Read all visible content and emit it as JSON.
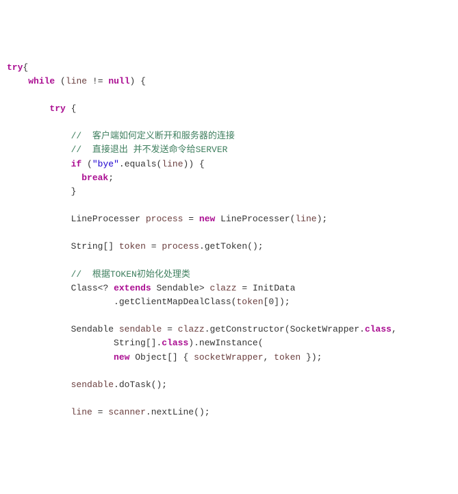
{
  "code": {
    "keywords": {
      "try": "try",
      "while": "while",
      "null": "null",
      "if": "if",
      "break": "break",
      "new": "new",
      "extends": "extends",
      "class": "class"
    },
    "identifiers": {
      "line": "line",
      "process": "process",
      "token": "token",
      "clazz": "clazz",
      "sendable": "sendable",
      "scanner": "scanner",
      "socketWrapper": "socketWrapper"
    },
    "types": {
      "LineProcesser": "LineProcesser",
      "String": "String",
      "Class": "Class",
      "Sendable": "Sendable",
      "InitData": "InitData",
      "SocketWrapper": "SocketWrapper",
      "Object": "Object"
    },
    "strings": {
      "bye": "\"bye\""
    },
    "comments": {
      "c1": "//  客户端如何定义断开和服务器的连接",
      "c2": "//  直接退出 并不发送命令给SERVER",
      "c3": "//  根据TOKEN初始化处理类"
    },
    "methods": {
      "equals": "equals",
      "getToken": "getToken",
      "getClientMapDealClass": "getClientMapDealClass",
      "getConstructor": "getConstructor",
      "newInstance": "newInstance",
      "doTask": "doTask",
      "nextLine": "nextLine"
    },
    "punct": {
      "lbrace": "{",
      "rbrace": "}",
      "lparen": "(",
      "rparen": ")",
      "lbrack": "[",
      "rbrack": "]",
      "semi": ";",
      "comma": ",",
      "dot": ".",
      "neq": "!=",
      "eq": "=",
      "lt": "<",
      "gt": ">",
      "qmark": "?",
      "zero": "0"
    }
  }
}
